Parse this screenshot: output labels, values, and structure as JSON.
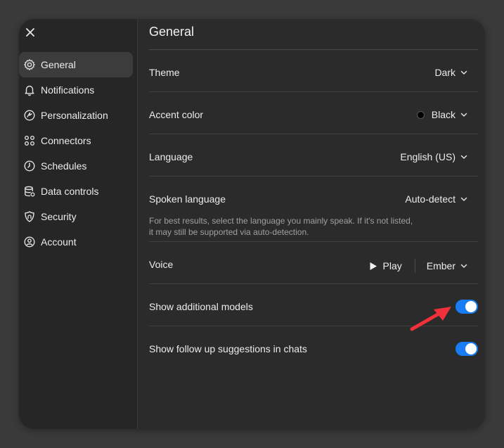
{
  "sidebar": {
    "close_icon": "close-icon",
    "items": [
      {
        "label": "General",
        "icon": "gear-icon",
        "active": true
      },
      {
        "label": "Notifications",
        "icon": "bell-icon"
      },
      {
        "label": "Personalization",
        "icon": "personalization-icon"
      },
      {
        "label": "Connectors",
        "icon": "connectors-icon"
      },
      {
        "label": "Schedules",
        "icon": "clock-icon"
      },
      {
        "label": "Data controls",
        "icon": "database-icon"
      },
      {
        "label": "Security",
        "icon": "shield-icon"
      },
      {
        "label": "Account",
        "icon": "user-icon"
      }
    ]
  },
  "main": {
    "title": "General",
    "theme": {
      "label": "Theme",
      "value": "Dark"
    },
    "accent": {
      "label": "Accent color",
      "value": "Black",
      "swatch_color": "#000000"
    },
    "language": {
      "label": "Language",
      "value": "English (US)"
    },
    "spoken": {
      "label": "Spoken language",
      "value": "Auto-detect",
      "help_line1": "For best results, select the language you mainly speak. If it's not listed,",
      "help_line2": "it may still be supported via auto-detection."
    },
    "voice": {
      "label": "Voice",
      "play_label": "Play",
      "value": "Ember"
    },
    "additional_models": {
      "label": "Show additional models",
      "enabled": true
    },
    "follow_up": {
      "label": "Show follow up suggestions in chats",
      "enabled": true
    }
  },
  "colors": {
    "toggle_on": "#1a7cf2",
    "annotation_arrow": "#f0303a"
  }
}
